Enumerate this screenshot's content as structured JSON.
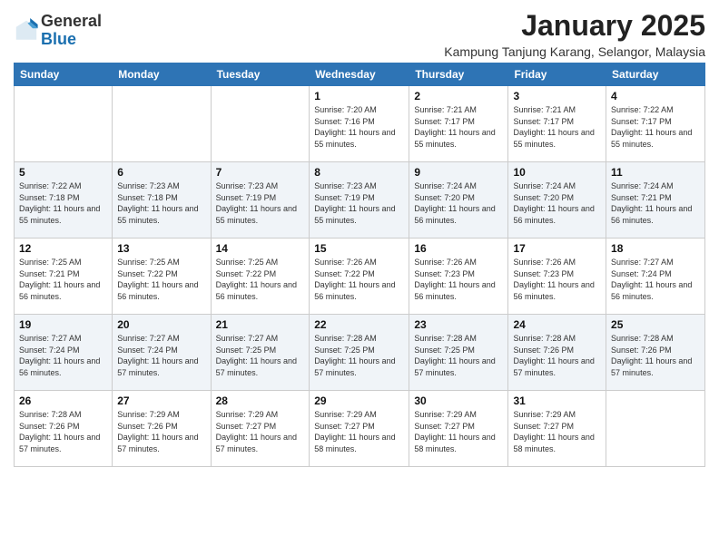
{
  "header": {
    "logo_general": "General",
    "logo_blue": "Blue",
    "main_title": "January 2025",
    "subtitle": "Kampung Tanjung Karang, Selangor, Malaysia"
  },
  "days_of_week": [
    "Sunday",
    "Monday",
    "Tuesday",
    "Wednesday",
    "Thursday",
    "Friday",
    "Saturday"
  ],
  "weeks": [
    [
      {
        "day": "",
        "info": ""
      },
      {
        "day": "",
        "info": ""
      },
      {
        "day": "",
        "info": ""
      },
      {
        "day": "1",
        "info": "Sunrise: 7:20 AM\nSunset: 7:16 PM\nDaylight: 11 hours and 55 minutes."
      },
      {
        "day": "2",
        "info": "Sunrise: 7:21 AM\nSunset: 7:17 PM\nDaylight: 11 hours and 55 minutes."
      },
      {
        "day": "3",
        "info": "Sunrise: 7:21 AM\nSunset: 7:17 PM\nDaylight: 11 hours and 55 minutes."
      },
      {
        "day": "4",
        "info": "Sunrise: 7:22 AM\nSunset: 7:17 PM\nDaylight: 11 hours and 55 minutes."
      }
    ],
    [
      {
        "day": "5",
        "info": "Sunrise: 7:22 AM\nSunset: 7:18 PM\nDaylight: 11 hours and 55 minutes."
      },
      {
        "day": "6",
        "info": "Sunrise: 7:23 AM\nSunset: 7:18 PM\nDaylight: 11 hours and 55 minutes."
      },
      {
        "day": "7",
        "info": "Sunrise: 7:23 AM\nSunset: 7:19 PM\nDaylight: 11 hours and 55 minutes."
      },
      {
        "day": "8",
        "info": "Sunrise: 7:23 AM\nSunset: 7:19 PM\nDaylight: 11 hours and 55 minutes."
      },
      {
        "day": "9",
        "info": "Sunrise: 7:24 AM\nSunset: 7:20 PM\nDaylight: 11 hours and 56 minutes."
      },
      {
        "day": "10",
        "info": "Sunrise: 7:24 AM\nSunset: 7:20 PM\nDaylight: 11 hours and 56 minutes."
      },
      {
        "day": "11",
        "info": "Sunrise: 7:24 AM\nSunset: 7:21 PM\nDaylight: 11 hours and 56 minutes."
      }
    ],
    [
      {
        "day": "12",
        "info": "Sunrise: 7:25 AM\nSunset: 7:21 PM\nDaylight: 11 hours and 56 minutes."
      },
      {
        "day": "13",
        "info": "Sunrise: 7:25 AM\nSunset: 7:22 PM\nDaylight: 11 hours and 56 minutes."
      },
      {
        "day": "14",
        "info": "Sunrise: 7:25 AM\nSunset: 7:22 PM\nDaylight: 11 hours and 56 minutes."
      },
      {
        "day": "15",
        "info": "Sunrise: 7:26 AM\nSunset: 7:22 PM\nDaylight: 11 hours and 56 minutes."
      },
      {
        "day": "16",
        "info": "Sunrise: 7:26 AM\nSunset: 7:23 PM\nDaylight: 11 hours and 56 minutes."
      },
      {
        "day": "17",
        "info": "Sunrise: 7:26 AM\nSunset: 7:23 PM\nDaylight: 11 hours and 56 minutes."
      },
      {
        "day": "18",
        "info": "Sunrise: 7:27 AM\nSunset: 7:24 PM\nDaylight: 11 hours and 56 minutes."
      }
    ],
    [
      {
        "day": "19",
        "info": "Sunrise: 7:27 AM\nSunset: 7:24 PM\nDaylight: 11 hours and 56 minutes."
      },
      {
        "day": "20",
        "info": "Sunrise: 7:27 AM\nSunset: 7:24 PM\nDaylight: 11 hours and 57 minutes."
      },
      {
        "day": "21",
        "info": "Sunrise: 7:27 AM\nSunset: 7:25 PM\nDaylight: 11 hours and 57 minutes."
      },
      {
        "day": "22",
        "info": "Sunrise: 7:28 AM\nSunset: 7:25 PM\nDaylight: 11 hours and 57 minutes."
      },
      {
        "day": "23",
        "info": "Sunrise: 7:28 AM\nSunset: 7:25 PM\nDaylight: 11 hours and 57 minutes."
      },
      {
        "day": "24",
        "info": "Sunrise: 7:28 AM\nSunset: 7:26 PM\nDaylight: 11 hours and 57 minutes."
      },
      {
        "day": "25",
        "info": "Sunrise: 7:28 AM\nSunset: 7:26 PM\nDaylight: 11 hours and 57 minutes."
      }
    ],
    [
      {
        "day": "26",
        "info": "Sunrise: 7:28 AM\nSunset: 7:26 PM\nDaylight: 11 hours and 57 minutes."
      },
      {
        "day": "27",
        "info": "Sunrise: 7:29 AM\nSunset: 7:26 PM\nDaylight: 11 hours and 57 minutes."
      },
      {
        "day": "28",
        "info": "Sunrise: 7:29 AM\nSunset: 7:27 PM\nDaylight: 11 hours and 57 minutes."
      },
      {
        "day": "29",
        "info": "Sunrise: 7:29 AM\nSunset: 7:27 PM\nDaylight: 11 hours and 58 minutes."
      },
      {
        "day": "30",
        "info": "Sunrise: 7:29 AM\nSunset: 7:27 PM\nDaylight: 11 hours and 58 minutes."
      },
      {
        "day": "31",
        "info": "Sunrise: 7:29 AM\nSunset: 7:27 PM\nDaylight: 11 hours and 58 minutes."
      },
      {
        "day": "",
        "info": ""
      }
    ]
  ]
}
